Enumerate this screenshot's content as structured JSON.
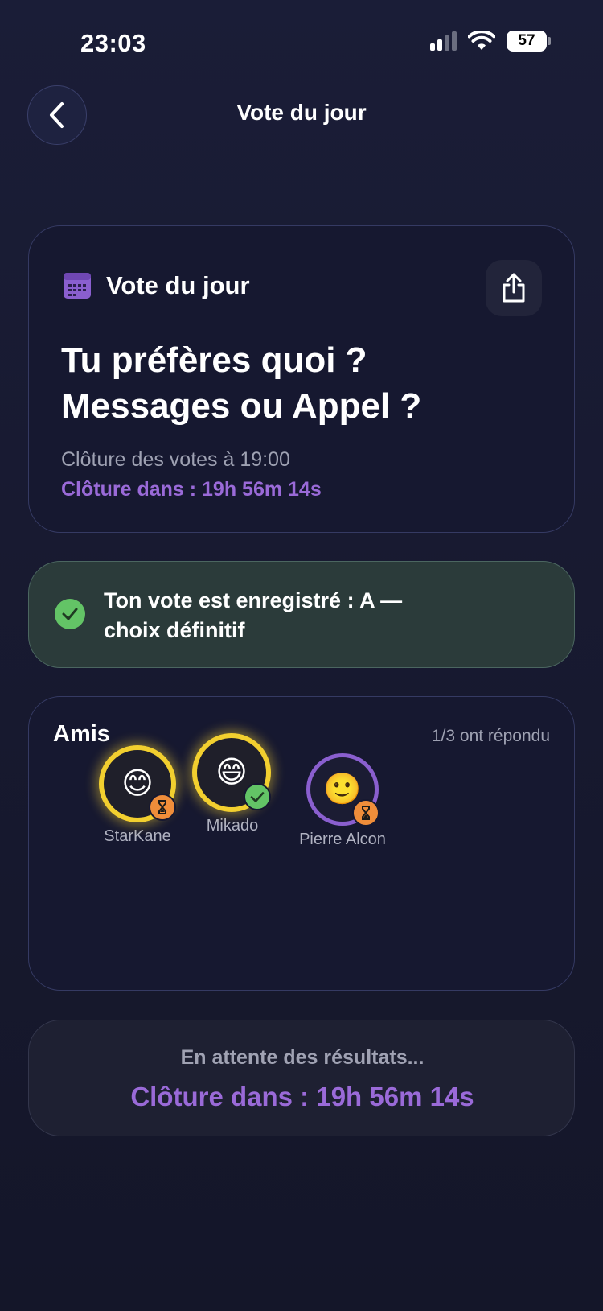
{
  "status_bar": {
    "time": "23:03",
    "battery": "57"
  },
  "nav": {
    "title": "Vote du jour",
    "back_icon": "chevron-left-icon"
  },
  "vote_card": {
    "header_label": "Vote du jour",
    "question_line1": "Tu préfères quoi ?",
    "question_line2": "Messages ou Appel ?",
    "closing_at": "Clôture des votes à 19:00",
    "countdown": "Clôture dans : 19h 56m 14s"
  },
  "confirmation": {
    "line1": "Ton vote est enregistré : A —",
    "line2": "choix définitif"
  },
  "friends": {
    "title": "Amis",
    "count": "1/3 ont répondu",
    "items": [
      {
        "name": "StarKane",
        "emoji": "😊",
        "status": "waiting"
      },
      {
        "name": "Mikado",
        "emoji": "😄",
        "status": "voted"
      },
      {
        "name": "Pierre Alcon",
        "emoji": "🙂",
        "status": "waiting"
      }
    ]
  },
  "results": {
    "waiting": "En attente des résultats...",
    "countdown": "Clôture dans : 19h 56m 14s"
  },
  "colors": {
    "background": "#181a31",
    "accent_purple": "#9a6ad8",
    "success_green": "#63c466",
    "gold_ring": "#f2cf2f",
    "waiting_orange": "#ef8d3a"
  }
}
